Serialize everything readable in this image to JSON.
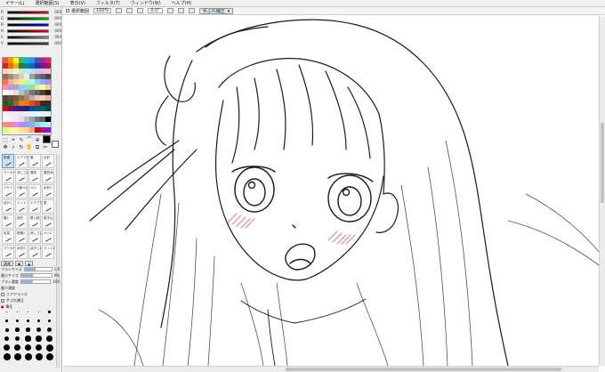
{
  "menu": [
    "イヤー(L)",
    "選択範囲(S)",
    "表示(V)",
    "フィルタ(T)",
    "ウィンドウ(W)",
    "ヘルプ(H)"
  ],
  "toolbar": {
    "selection_label": "選択範囲",
    "zoom_value": "100%",
    "rotation_value": "0.0°",
    "canvas_tab": "手ぶれ補正"
  },
  "color_sliders": [
    {
      "label": "R",
      "value": "000",
      "color": "#ff0000"
    },
    {
      "label": "G",
      "value": "000",
      "color": "#00c000"
    },
    {
      "label": "B",
      "value": "000",
      "color": "#0000ff"
    },
    {
      "label": "H",
      "value": "000",
      "color": "#ff0000"
    },
    {
      "label": "S",
      "value": "000",
      "color": "#888888"
    },
    {
      "label": "V",
      "value": "000",
      "color": "#444444"
    }
  ],
  "swatch_colors": [
    "#ff4c4c",
    "#ff9a00",
    "#ffff00",
    "#4caf50",
    "#00bcd4",
    "#2196f3",
    "#3f51b5",
    "#9c27b0",
    "#e91e63",
    "#c62828",
    "#ef6c00",
    "#f9a825",
    "#2e7d32",
    "#00838f",
    "#1565c0",
    "#283593",
    "#6a1b9a",
    "#ad1457",
    "#ffcdd2",
    "#ffe0b2",
    "#fff9c4",
    "#c8e6c9",
    "#b2ebf2",
    "#bbdefb",
    "#c5cae9",
    "#e1bee7",
    "#f8bbd0",
    "#8d6e63",
    "#a1887f",
    "#bcaaa4",
    "#d7ccc8",
    "#efebe9",
    "#9e9e9e",
    "#757575",
    "#616161",
    "#424242",
    "#ff7043",
    "#ffab91",
    "#ffd180",
    "#ffe57f",
    "#ccff90",
    "#a7ffeb",
    "#80d8ff",
    "#82b1ff",
    "#b388ff",
    "#f48fb1",
    "#ce93d8",
    "#9fa8da",
    "#90caf9",
    "#80deea",
    "#a5d6a7",
    "#e6ee9c",
    "#fff59d",
    "#ffcc80",
    "#ffffff",
    "#eeeeee",
    "#e0e0e0",
    "#bdbdbd",
    "#9e9e9e",
    "#757575",
    "#616161",
    "#424242",
    "#212121",
    "#5d4037",
    "#6d4c41",
    "#795548",
    "#8d6e63",
    "#a1887f",
    "#bcaaa4",
    "#d7ccc8",
    "#ffccbc",
    "#ffab91",
    "#1b5e20",
    "#33691e",
    "#827717",
    "#f57f17",
    "#ff6f00",
    "#e65100",
    "#bf360c",
    "#3e2723",
    "#263238",
    "#b71c1c",
    "#880e4f",
    "#4a148c",
    "#311b92",
    "#1a237e",
    "#0d47a1",
    "#01579b",
    "#006064",
    "#004d40",
    "#ffebee",
    "#fce4ec",
    "#f3e5f5",
    "#ede7f6",
    "#e8eaf6",
    "#e3f2fd",
    "#e1f5fe",
    "#e0f7fa",
    "#e0f2f1",
    "#fafafa",
    "#f5f5f5",
    "#eeeeee",
    "#e0e0e0",
    "#bdbdbd",
    "#9e9e9e",
    "#757575",
    "#616161",
    "#000000",
    "#ff8a80",
    "#ff80ab",
    "#ea80fc",
    "#b388ff",
    "#8c9eff",
    "#82b1ff",
    "#80d8ff",
    "#84ffff",
    "#a7ffeb",
    "#ccff90",
    "#f4ff81",
    "#ffff8d",
    "#ffe57f",
    "#ffd180",
    "#ff9e80",
    "#d50000",
    "#c51162",
    "#aa00ff"
  ],
  "tools": [
    "⬚",
    "⌖",
    "✎",
    "⌒",
    "⊕",
    "T",
    "✥",
    "⌕",
    "↻",
    "✋",
    "⧉",
    "✂"
  ],
  "brushes": [
    "鉛筆",
    "エアブラシ",
    "筆",
    "水彩",
    "マーカー",
    "消しゴム",
    "選択",
    "選択消",
    "バケツ",
    "2値ペン",
    "ペン",
    "水彩2",
    "ぼかし",
    "ドット",
    "エアブラシ",
    "墨",
    "筆2",
    "指先",
    "覆い焼",
    "焼き込",
    "色混",
    "鉛筆2",
    "消しゴム2",
    "ペン2",
    "マーカー2",
    "水彩3",
    "ぼかし2",
    "ドット2"
  ],
  "props": {
    "blend_label": "通常",
    "brush_size_label": "ブラシサイズ",
    "brush_size_value": "1.0",
    "min_size_label": "最小サイズ",
    "min_size_value": "0%",
    "density_label": "ブラシ濃度",
    "density_value": "100",
    "edge_label": "最小濃度",
    "opt1_label": "ニアアライズ",
    "opt2_label": "手ぶれ補正",
    "opt3_label": "その他",
    "pressure_label": "筆圧"
  },
  "dot_sizes": [
    "0.5",
    "0.7",
    "1",
    "1.5",
    "2",
    "3",
    "4",
    "5",
    "6",
    "7",
    "8",
    "9",
    "10",
    "12",
    "14",
    "16",
    "20",
    "25",
    "30",
    "35",
    "40",
    "50",
    "60",
    "70",
    "80",
    "90",
    "100",
    "120",
    "150",
    "200"
  ]
}
